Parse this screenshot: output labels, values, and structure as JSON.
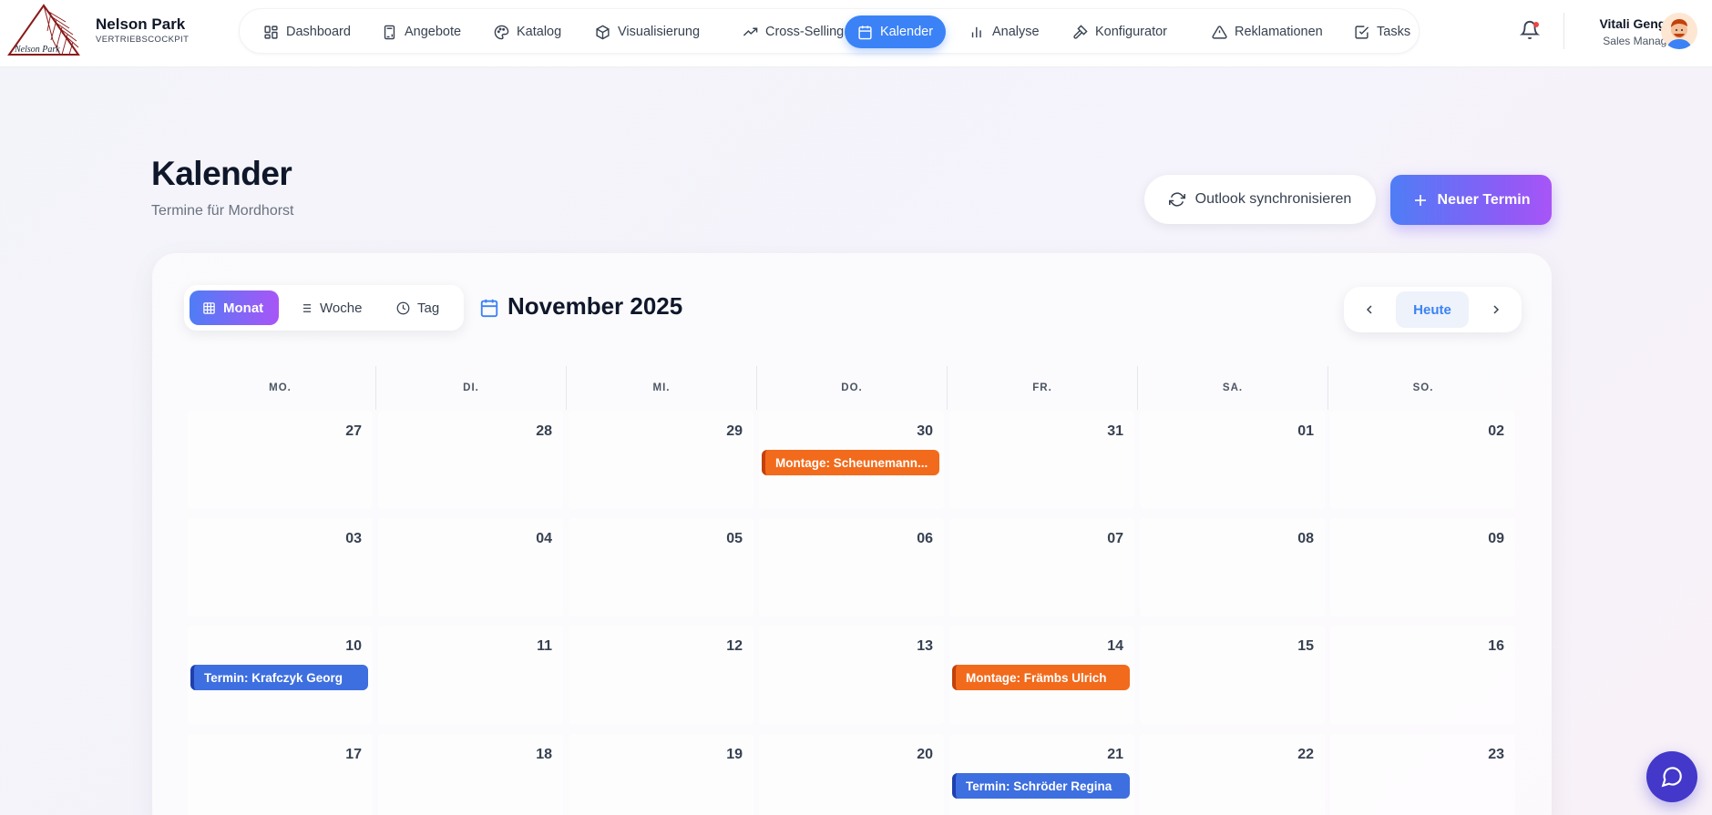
{
  "brand": {
    "name": "Nelson Park",
    "subtitle": "VERTRIEBSCOCKPIT",
    "logo_text": "Nelson Park"
  },
  "nav": {
    "items": [
      {
        "label": "Dashboard",
        "icon": "dashboard-icon"
      },
      {
        "label": "Angebote",
        "icon": "calculator-icon"
      },
      {
        "label": "Katalog",
        "icon": "palette-icon"
      },
      {
        "label": "Visualisierung",
        "icon": "cube-icon"
      },
      {
        "label": "Cross-Selling",
        "icon": "trending-up-icon"
      },
      {
        "label": "Kalender",
        "icon": "calendar-icon",
        "active": true
      },
      {
        "label": "Analyse",
        "icon": "bar-chart-icon"
      },
      {
        "label": "Konfigurator",
        "icon": "hammer-icon"
      },
      {
        "label": "Reklamationen",
        "icon": "warning-icon"
      },
      {
        "label": "Tasks",
        "icon": "check-square-icon"
      }
    ]
  },
  "user": {
    "name": "Vitali Gengel",
    "role": "Sales Manager"
  },
  "page": {
    "title": "Kalender",
    "subtitle": "Termine für Mordhorst",
    "sync_label": "Outlook synchronisieren",
    "new_label": "Neuer Termin"
  },
  "calendar": {
    "views": {
      "month": "Monat",
      "week": "Woche",
      "day": "Tag",
      "active": "month"
    },
    "month_title": "November 2025",
    "today_label": "Heute",
    "weekdays": [
      "MO.",
      "DI.",
      "MI.",
      "DO.",
      "FR.",
      "SA.",
      "SO."
    ],
    "weeks": [
      [
        {
          "num": "27"
        },
        {
          "num": "28"
        },
        {
          "num": "29"
        },
        {
          "num": "30",
          "event": {
            "label": "Montage: Scheunemann...",
            "type": "orange"
          }
        },
        {
          "num": "31"
        },
        {
          "num": "01"
        },
        {
          "num": "02"
        }
      ],
      [
        {
          "num": "03"
        },
        {
          "num": "04"
        },
        {
          "num": "05"
        },
        {
          "num": "06"
        },
        {
          "num": "07"
        },
        {
          "num": "08"
        },
        {
          "num": "09"
        }
      ],
      [
        {
          "num": "10",
          "event": {
            "label": "Termin: Krafczyk Georg",
            "type": "blue"
          }
        },
        {
          "num": "11"
        },
        {
          "num": "12"
        },
        {
          "num": "13"
        },
        {
          "num": "14",
          "event": {
            "label": "Montage: Främbs Ulrich",
            "type": "orange"
          }
        },
        {
          "num": "15"
        },
        {
          "num": "16"
        }
      ],
      [
        {
          "num": "17"
        },
        {
          "num": "18"
        },
        {
          "num": "19"
        },
        {
          "num": "20"
        },
        {
          "num": "21",
          "event": {
            "label": "Termin: Schröder Regina",
            "type": "blue"
          }
        },
        {
          "num": "22"
        },
        {
          "num": "23"
        }
      ]
    ]
  },
  "colors": {
    "accent": "#3b82f6",
    "event_orange": "#f26a1b",
    "event_blue": "#3e6fe0",
    "gradient_start": "#4f7df6",
    "gradient_end": "#a855f7",
    "notification_dot": "#ef4444"
  }
}
